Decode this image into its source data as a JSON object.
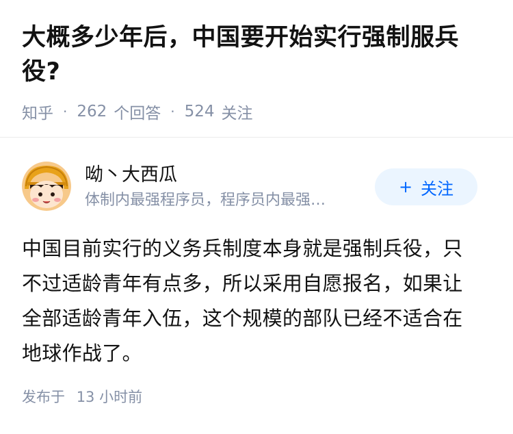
{
  "question": {
    "title": "大概多少年后，中国要开始实行强制服兵役?",
    "source": "知乎",
    "answer_count": "262",
    "answer_label": "个回答",
    "follower_count": "524",
    "follower_label": "关注"
  },
  "answer": {
    "author": {
      "name": "呦丶大西瓜",
      "bio": "体制内最强程序员，程序员内最强…",
      "avatar_icon": "cartoon-girl-avatar"
    },
    "follow_button": {
      "plus": "+",
      "label": "关注"
    },
    "content": "中国目前实行的义务兵制度本身就是强制兵役，只不过适龄青年有点多，所以采用自愿报名，如果让全部适龄青年入伍，这个规模的部队已经不适合在地球作战了。",
    "published_label": "发布于",
    "published_time": "13 小时前"
  },
  "colors": {
    "accent": "#0066ff",
    "follow_bg": "#ebf5ff",
    "meta_gray": "#8590a6",
    "text": "#121212"
  }
}
